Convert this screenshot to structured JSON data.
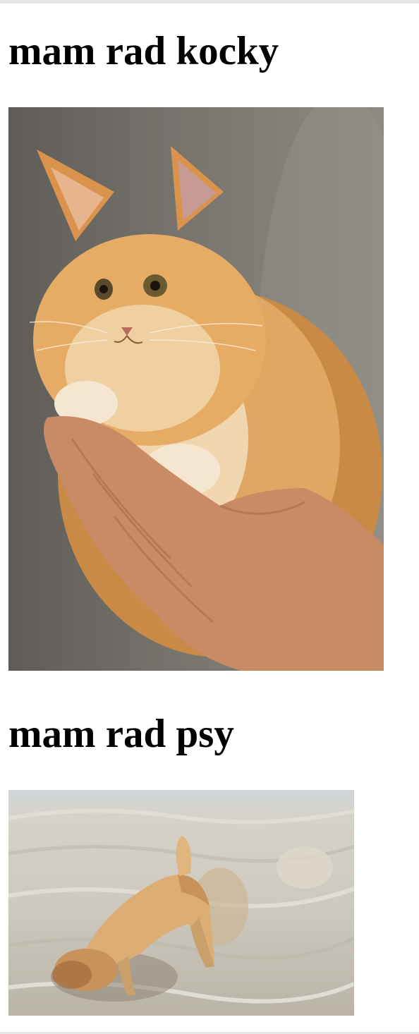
{
  "sections": [
    {
      "heading": "mam rad kocky",
      "image_alt": "orange kitten held in a hand"
    },
    {
      "heading": "mam rad psy",
      "image_alt": "puppy digging in beach sand"
    }
  ],
  "colors": {
    "background": "#ffffff",
    "heading": "#000000",
    "kitten_fur": "#e3a45f",
    "sand": "#cdc8bd"
  }
}
